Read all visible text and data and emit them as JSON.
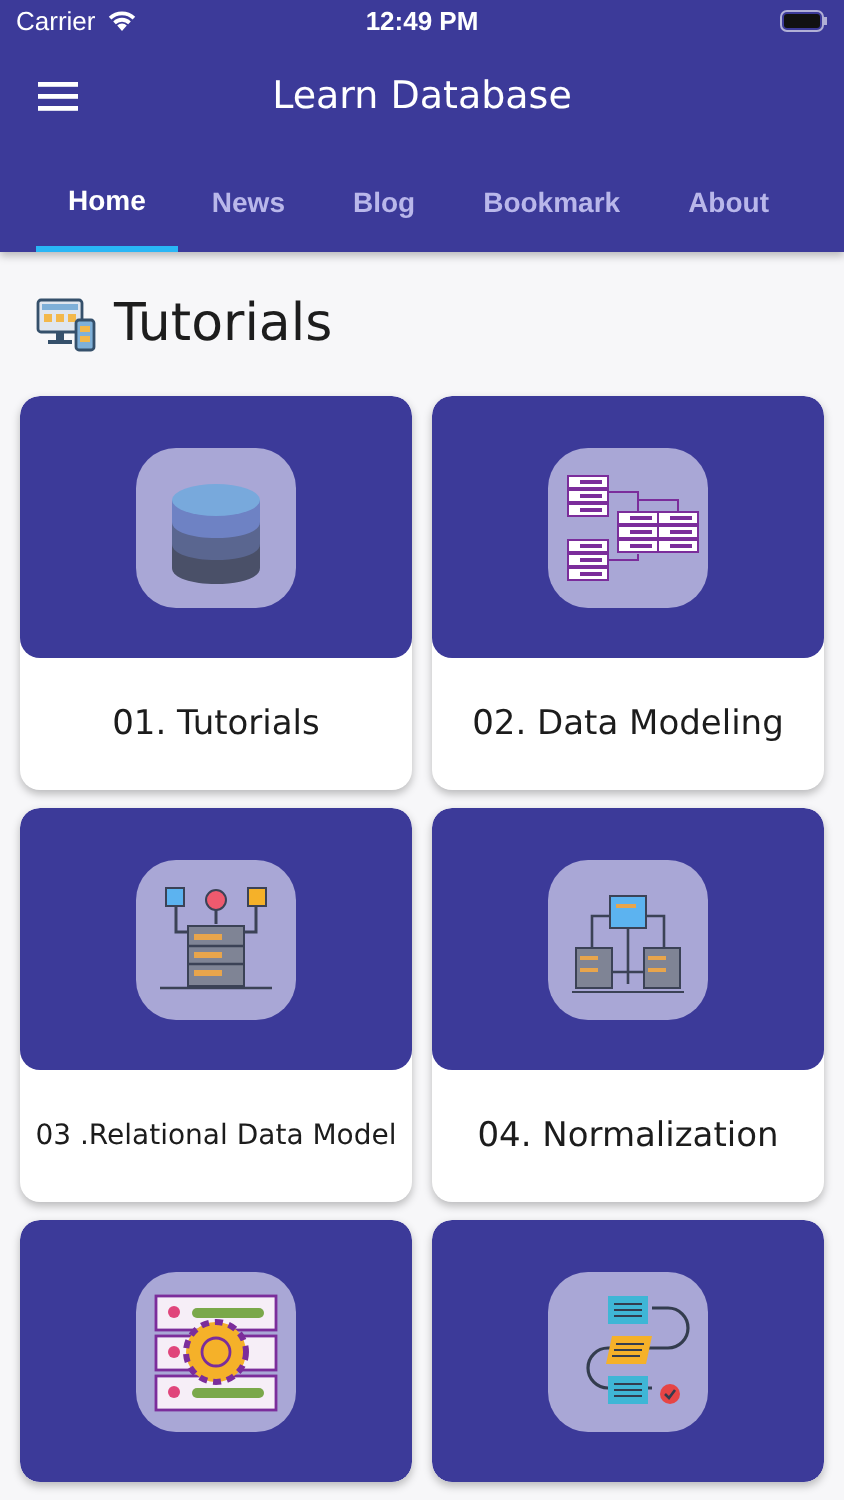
{
  "status_bar": {
    "carrier": "Carrier",
    "time": "12:49 PM"
  },
  "app_bar": {
    "title": "Learn Database"
  },
  "tabs": [
    {
      "label": "Home",
      "selected": true
    },
    {
      "label": "News",
      "selected": false
    },
    {
      "label": "Blog",
      "selected": false
    },
    {
      "label": "Bookmark",
      "selected": false
    },
    {
      "label": "About",
      "selected": false
    }
  ],
  "section": {
    "title": "Tutorials"
  },
  "cards": [
    {
      "kind": "database",
      "title": "01. Tutorials"
    },
    {
      "kind": "modeling",
      "title": "02. Data Modeling"
    },
    {
      "kind": "relational",
      "title": "03 .Relational Data Model"
    },
    {
      "kind": "normalization",
      "title": "04. Normalization"
    },
    {
      "kind": "server-gear"
    },
    {
      "kind": "flow"
    }
  ]
}
